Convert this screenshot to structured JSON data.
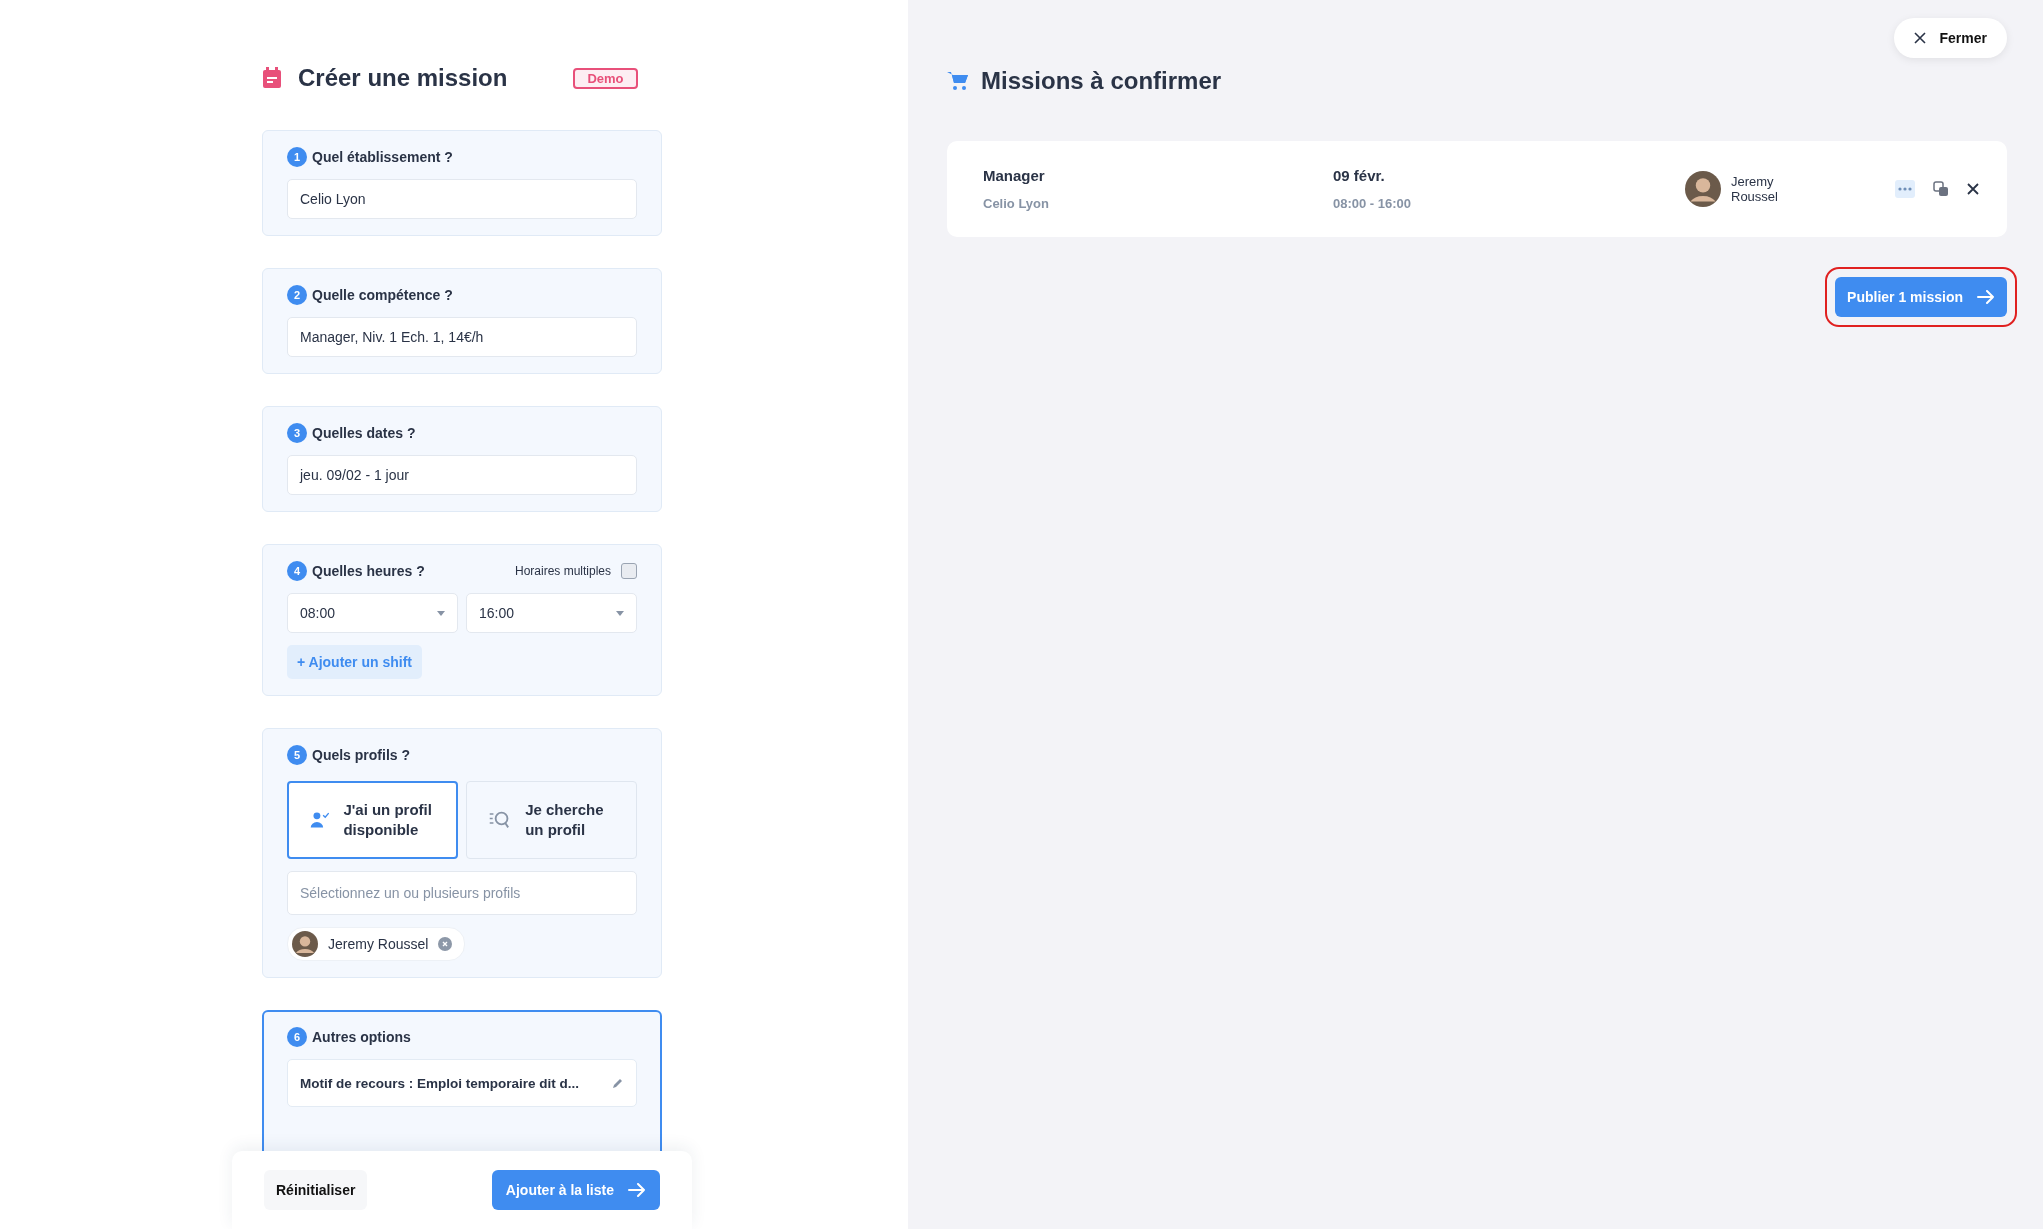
{
  "header": {
    "title": "Créer une mission",
    "badge": "Demo"
  },
  "sections": [
    {
      "kind": "input",
      "number": "1",
      "title": "Quel établissement ?",
      "value": "Celio Lyon",
      "focused": false
    },
    {
      "kind": "input",
      "number": "2",
      "title": "Quelle compétence ?",
      "value": "Manager, Niv. 1 Ech. 1, 14€/h",
      "focused": false
    },
    {
      "kind": "input",
      "number": "3",
      "title": "Quelles dates ?",
      "value": "jeu. 09/02 - 1 jour",
      "focused": false
    },
    {
      "kind": "hours",
      "number": "4",
      "title": "Quelles heures ?",
      "focused": false,
      "toggle": {
        "label": "Horaires multiples",
        "checked": false
      },
      "start": "08:00",
      "end": "16:00",
      "add_button": "+ Ajouter un shift"
    },
    {
      "kind": "profiles",
      "number": "5",
      "title": "Quels profils ?",
      "focused": false,
      "choices": [
        {
          "label": "J'ai un profil disponible",
          "selected": true
        },
        {
          "label": "Je cherche un profil",
          "selected": false
        }
      ],
      "placeholder": "Sélectionnez un ou plusieurs profils",
      "chips": [
        "Jeremy Roussel"
      ]
    },
    {
      "kind": "options",
      "number": "6",
      "title": "Autres options",
      "focused": true,
      "options": [
        "Motif de recours : Emploi temporaire dit d..."
      ]
    }
  ],
  "footer": {
    "reset": "Réinitialiser",
    "submit": "Ajouter à la liste"
  },
  "close_button": "Fermer",
  "cart": {
    "title": "Missions à confirmer",
    "missions": [
      {
        "role": "Manager",
        "place": "Celio Lyon",
        "date": "09 févr.",
        "hours": "08:00 - 16:00",
        "person": "Jeremy Roussel"
      }
    ],
    "publish": {
      "label": "Publier 1 mission",
      "highlighted": true
    }
  }
}
